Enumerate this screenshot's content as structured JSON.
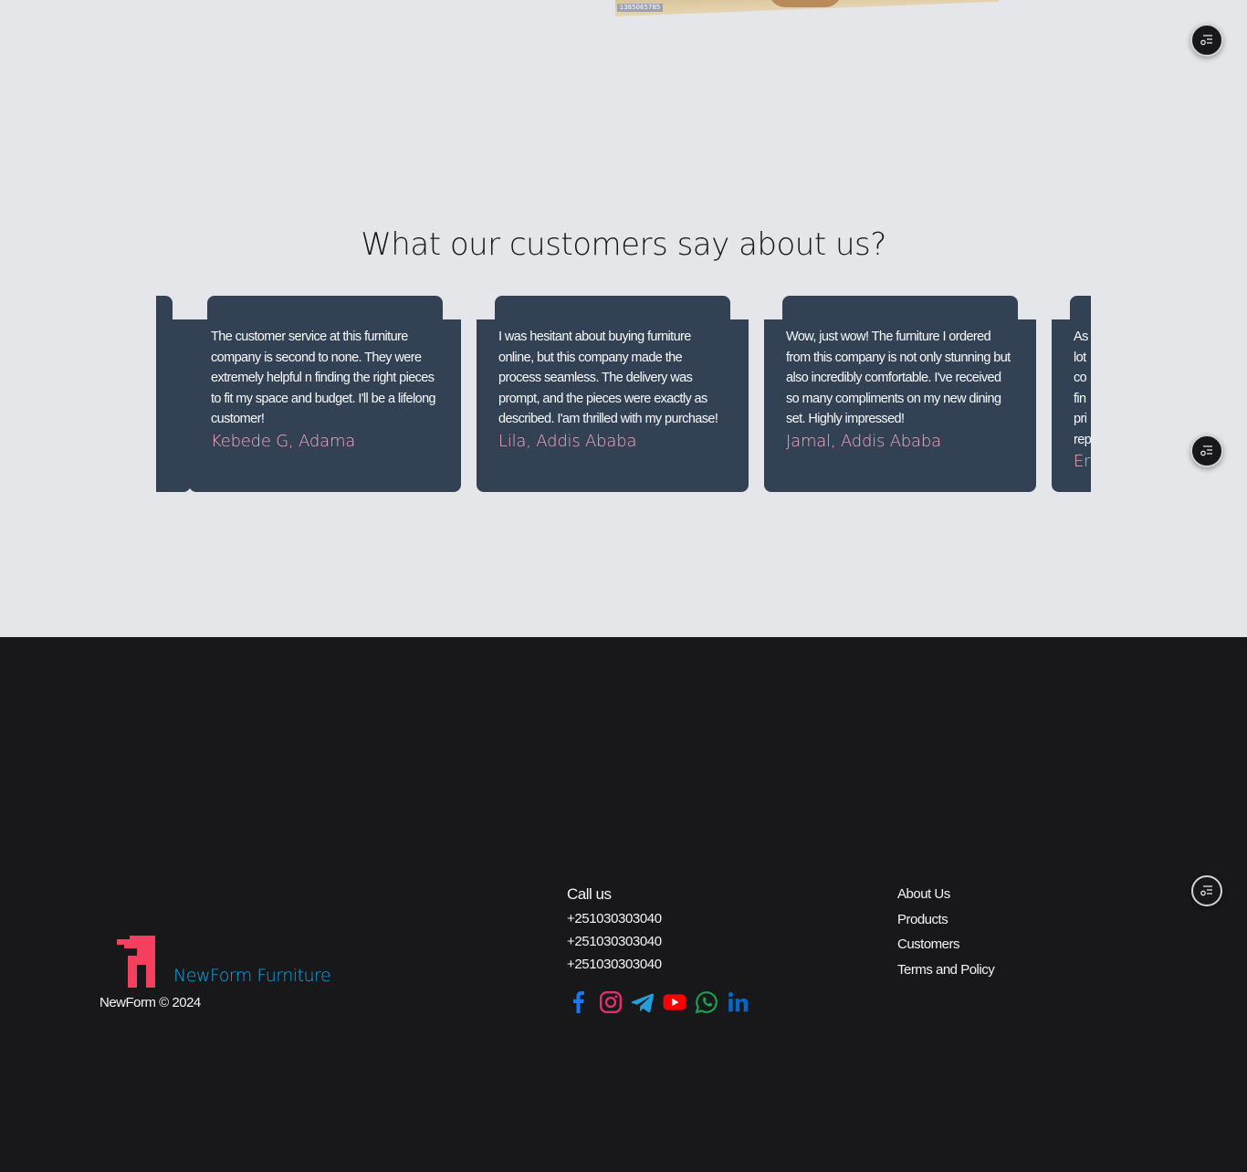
{
  "top_image": {
    "stamp_text": "1385065785"
  },
  "testimonials": {
    "title": "What our customers say about us?",
    "cards": [
      {
        "quote": "",
        "author": ""
      },
      {
        "quote": "The customer service at this furniture company is second to none. They were extremely helpful n finding the right pieces to fit my space and budget. I'll be a lifelong customer!",
        "author": "Kebede G, Adama"
      },
      {
        "quote": "I was hesitant about buying furniture online, but this company made the process seamless. The delivery was prompt, and the pieces were exactly as described. I'am thrilled with my purchase!",
        "author": "Lila, Addis Ababa"
      },
      {
        "quote": "Wow, just wow! The furniture I ordered from this company is not only stunning but also incredibly comfortable. I've received so many compliments on my new dining set. Highly impressed!",
        "author": "Jamal, Addis Ababa"
      },
      {
        "quote": "As lot co fin pri rep",
        "author": "Er"
      }
    ]
  },
  "footer": {
    "brand_name": "NewForm Furniture",
    "copyright": "NewForm © 2024",
    "contact": {
      "title": "Call us",
      "phones": [
        "+251030303040",
        "+251030303040",
        "+251030303040"
      ]
    },
    "socials": [
      "facebook-icon",
      "instagram-icon",
      "telegram-icon",
      "youtube-icon",
      "whatsapp-icon",
      "linkedin-icon"
    ],
    "links": [
      "About Us",
      "Products",
      "Customers",
      "Terms and Policy"
    ]
  },
  "colors": {
    "page_bg": "#e5e6ea",
    "card_bg": "#334155",
    "author_pink": "#f9a8c0",
    "footer_bg": "#18181b",
    "brand_blue": "#0ea5e9",
    "logo_red": "#f43f5e"
  }
}
